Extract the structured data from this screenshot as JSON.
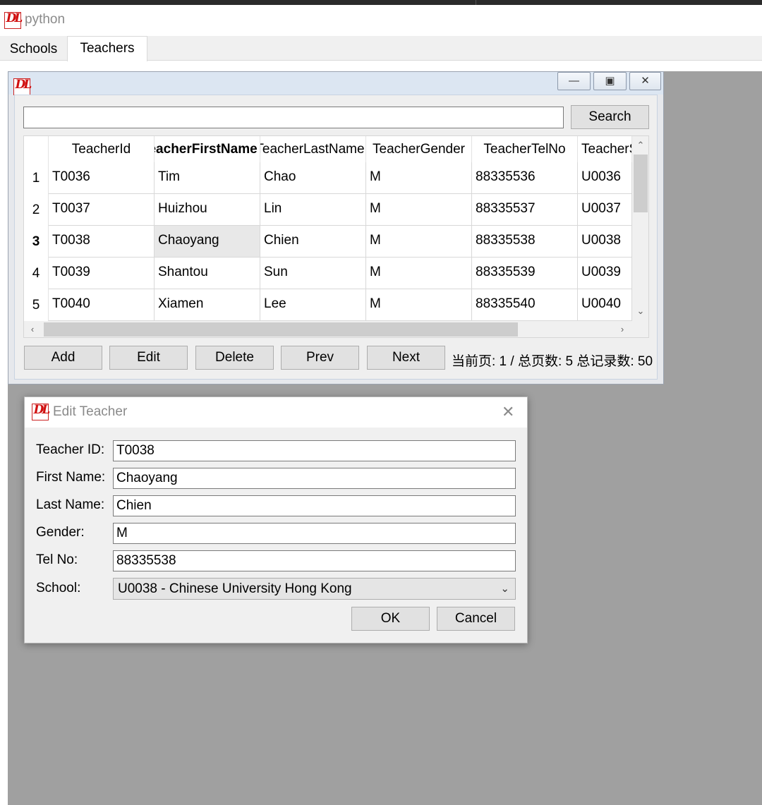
{
  "app": {
    "title": "python"
  },
  "tabs": [
    {
      "label": "Schools"
    },
    {
      "label": "Teachers"
    }
  ],
  "teachers_window": {
    "search_value": "",
    "search_label": "Search",
    "columns": [
      "TeacherId",
      "TeacherFirstName",
      "TeacherLastName",
      "TeacherGender",
      "TeacherTelNo",
      "TeacherSchoolId"
    ],
    "rows": [
      {
        "num": "1",
        "cells": [
          "T0036",
          "Tim",
          "Chao",
          "M",
          "88335536",
          "U0036"
        ]
      },
      {
        "num": "2",
        "cells": [
          "T0037",
          "Huizhou",
          "Lin",
          "M",
          "88335537",
          "U0037"
        ]
      },
      {
        "num": "3",
        "cells": [
          "T0038",
          "Chaoyang",
          "Chien",
          "M",
          "88335538",
          "U0038"
        ]
      },
      {
        "num": "4",
        "cells": [
          "T0039",
          "Shantou",
          "Sun",
          "M",
          "88335539",
          "U0039"
        ]
      },
      {
        "num": "5",
        "cells": [
          "T0040",
          "Xiamen",
          "Lee",
          "M",
          "88335540",
          "U0040"
        ]
      }
    ],
    "buttons": {
      "add": "Add",
      "edit": "Edit",
      "delete": "Delete",
      "prev": "Prev",
      "next": "Next"
    },
    "page_info": "当前页: 1 / 总页数: 5  总记录数: 50"
  },
  "edit_dialog": {
    "title": "Edit Teacher",
    "labels": {
      "id": "Teacher ID:",
      "first": "First Name:",
      "last": "Last Name:",
      "gender": "Gender:",
      "tel": "Tel No:",
      "school": "School:"
    },
    "values": {
      "id": "T0038",
      "first": "Chaoyang",
      "last": "Chien",
      "gender": "M",
      "tel": "88335538",
      "school": "U0038 - Chinese University Hong Kong"
    },
    "ok": "OK",
    "cancel": "Cancel"
  }
}
